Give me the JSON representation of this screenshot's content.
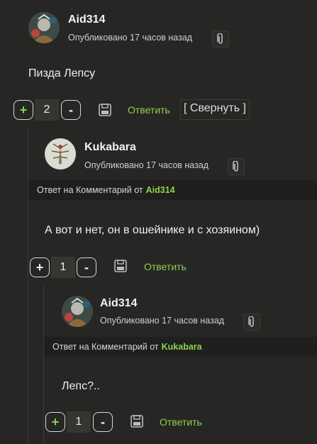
{
  "comments": [
    {
      "author": "Aid314",
      "meta": "Опубликовано 17 часов назад",
      "reply_prefix": "",
      "reply_to": "",
      "text": "Пизда Лепсу",
      "votes": "2",
      "plus_label": "+",
      "minus_label": "-",
      "reply_label": "Ответить",
      "collapse_label": "[ Свернуть ]"
    },
    {
      "author": "Kukabara",
      "meta": "Опубликовано 17 часов назад",
      "reply_prefix": "Ответ на Комментарий от",
      "reply_to": "Aid314",
      "text": "А вот и нет, он в ошейнике и с хозяином)",
      "votes": "1",
      "plus_label": "+",
      "minus_label": "-",
      "reply_label": "Ответить"
    },
    {
      "author": "Aid314",
      "meta": "Опубликовано 17 часов назад",
      "reply_prefix": "Ответ на Комментарий от",
      "reply_to": "Kukabara",
      "text": "Лепс?..",
      "votes": "1",
      "plus_label": "+",
      "minus_label": "-",
      "reply_label": "Ответить"
    }
  ],
  "colors": {
    "background": "#262624",
    "accent_green": "#8fd14f",
    "reply_bar": "#1f1f1e",
    "vote_count_bg": "#353532"
  },
  "icons": [
    "paperclip-icon",
    "save-icon"
  ]
}
